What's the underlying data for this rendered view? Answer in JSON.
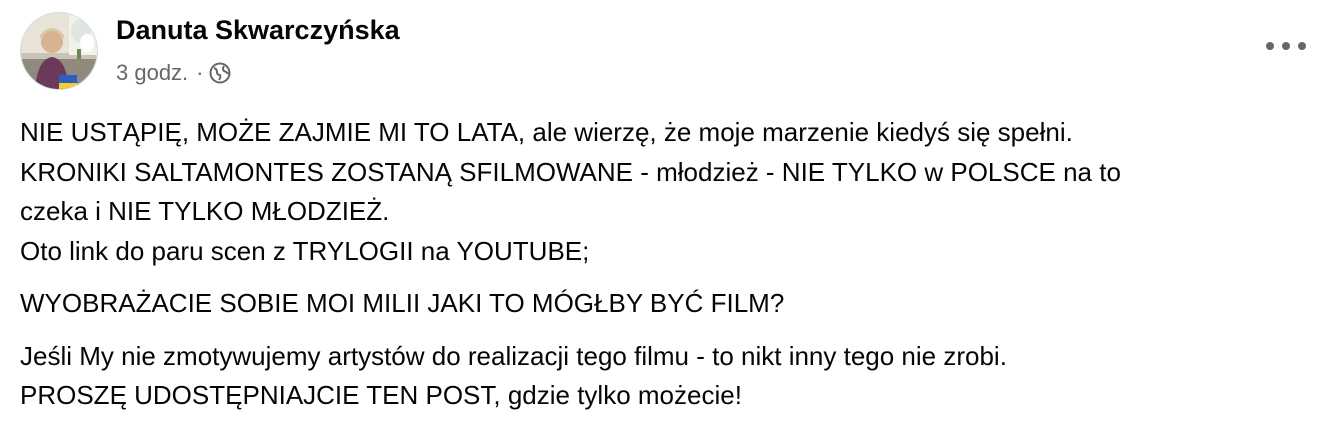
{
  "post": {
    "author": "Danuta Skwarczyńska",
    "time": "3 godz.",
    "separator": "·",
    "audience_icon": "globe-icon",
    "more_icon": "more-options-icon",
    "paragraphs": [
      {
        "lines": [
          "NIE USTĄPIĘ, MOŻE ZAJMIE MI TO LATA, ale wierzę, że moje marzenie kiedyś się spełni.",
          "KRONIKI SALTAMONTES ZOSTANĄ SFILMOWANE - młodzież - NIE TYLKO w POLSCE na to",
          "czeka i NIE TYLKO MŁODZIEŻ.",
          "Oto link do paru scen  z TRYLOGII na YOUTUBE;"
        ]
      },
      {
        "lines": [
          "WYOBRAŻACIE SOBIE MOI MILII JAKI TO MÓGŁBY BYĆ FILM?"
        ]
      },
      {
        "lines": [
          "Jeśli My nie zmotywujemy artystów do realizacji tego filmu - to nikt inny tego nie zrobi.",
          "PROSZĘ UDOSTĘPNIAJCIE TEN POST, gdzie tylko możecie!"
        ]
      }
    ]
  },
  "colors": {
    "text": "#050505",
    "secondary": "#65676b",
    "background": "#ffffff"
  }
}
